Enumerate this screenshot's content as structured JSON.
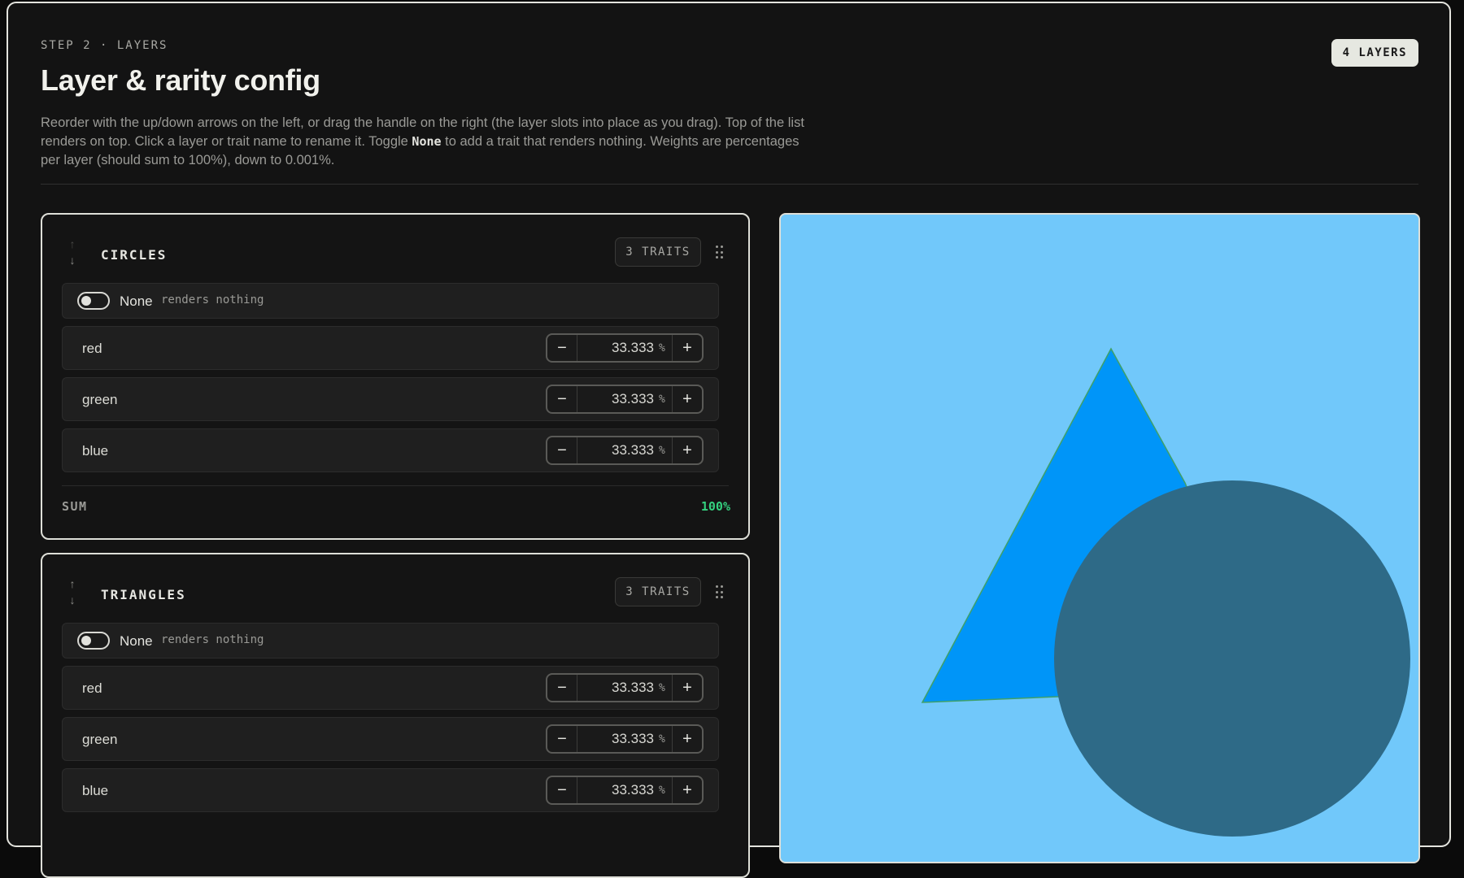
{
  "header": {
    "step": "STEP 2 · LAYERS",
    "title": "Layer & rarity config",
    "desc_part1": "Reorder with the up/down arrows on the left, or drag the handle on the right (the layer slots into place as you drag). Top of the list renders on top. Click a layer or trait name to rename it. Toggle ",
    "desc_keyword": "None",
    "desc_part2": " to add a trait that renders nothing. Weights are percentages per layer (should sum to 100%), down to 0.001%.",
    "layers_badge": "4 LAYERS"
  },
  "layers": [
    {
      "name": "CIRCLES",
      "traits_badge": "3 TRAITS",
      "none_label": "None",
      "none_hint": "renders nothing",
      "none_enabled": false,
      "traits": [
        {
          "name": "red",
          "weight": "33.333"
        },
        {
          "name": "green",
          "weight": "33.333"
        },
        {
          "name": "blue",
          "weight": "33.333"
        }
      ],
      "sum_label": "SUM",
      "sum_value": "100%"
    },
    {
      "name": "TRIANGLES",
      "traits_badge": "3 TRAITS",
      "none_label": "None",
      "none_hint": "renders nothing",
      "none_enabled": false,
      "traits": [
        {
          "name": "red",
          "weight": "33.333"
        },
        {
          "name": "green",
          "weight": "33.333"
        },
        {
          "name": "blue",
          "weight": "33.333"
        }
      ]
    }
  ],
  "stepper": {
    "minus": "−",
    "plus": "+",
    "unit": "%"
  },
  "arrows": {
    "up": "↑",
    "down": "↓"
  },
  "colors": {
    "preview_background": "#71c8fa",
    "triangle_fill": "#0095f8",
    "circle_fill": "#2e6a87",
    "sum_ok": "#34d17f"
  }
}
